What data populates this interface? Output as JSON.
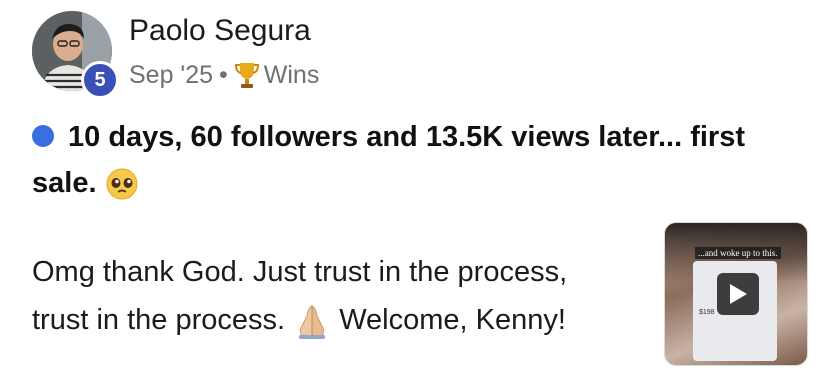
{
  "post": {
    "author": "Paolo Segura",
    "level": "5",
    "date": "Sep '25",
    "separator": "•",
    "category": "Wins",
    "title": "10 days, 60 followers and 13.5K views later... first sale.",
    "body_line_1": "Omg thank God. Just trust in the process,",
    "body_line_2": "trust in the process.",
    "body_line_2_end": "Welcome, Kenny!"
  },
  "thumbnail": {
    "caption": "...and woke up to this.",
    "stat": "$198"
  },
  "icons": {
    "avatar": "avatar-photo",
    "trophy": "trophy-icon",
    "dot": "unread-dot-icon",
    "pleading": "pleading-face-emoji",
    "praying": "folded-hands-emoji",
    "play": "play-icon"
  },
  "colors": {
    "badge": "#3b4fb8",
    "dot": "#3b6fe0",
    "meta_text": "#707070"
  }
}
